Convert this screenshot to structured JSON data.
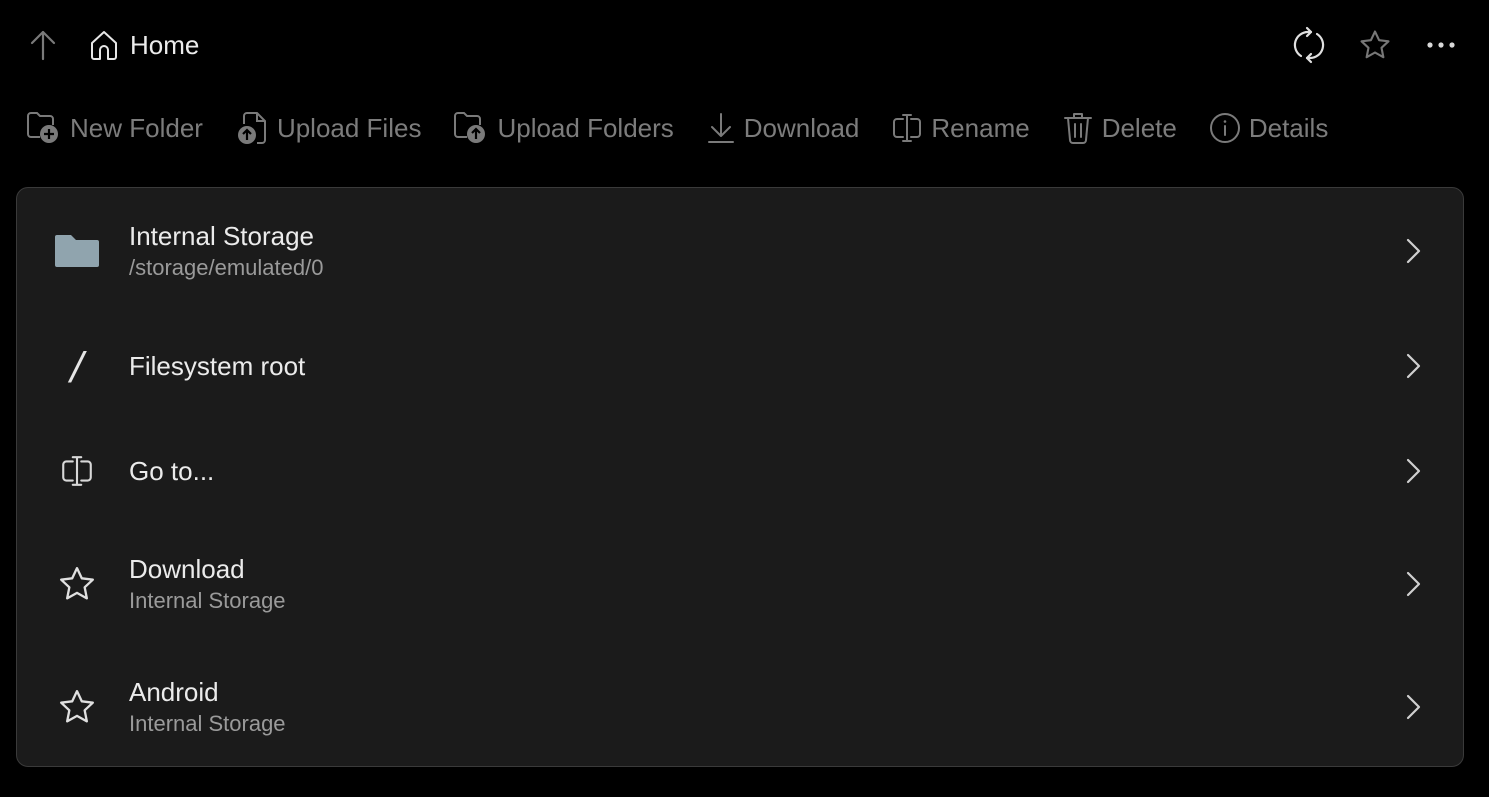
{
  "topbar": {
    "up_icon": "arrow-up-icon",
    "home_icon": "home-icon",
    "breadcrumb_label": "Home",
    "actions": [
      {
        "name": "refresh",
        "icon": "refresh-icon"
      },
      {
        "name": "favorite",
        "icon": "star-icon"
      },
      {
        "name": "more",
        "icon": "more-horizontal-icon"
      }
    ]
  },
  "toolbar": {
    "items": [
      {
        "label": "New Folder",
        "icon": "folder-add-icon"
      },
      {
        "label": "Upload Files",
        "icon": "file-upload-icon"
      },
      {
        "label": "Upload Folders",
        "icon": "folder-upload-icon"
      },
      {
        "label": "Download",
        "icon": "download-icon"
      },
      {
        "label": "Rename",
        "icon": "rename-icon"
      },
      {
        "label": "Delete",
        "icon": "trash-icon"
      },
      {
        "label": "Details",
        "icon": "info-icon"
      }
    ]
  },
  "locations": [
    {
      "title": "Internal Storage",
      "subtitle": "/storage/emulated/0",
      "icon": "folder-icon"
    },
    {
      "title": "Filesystem root",
      "subtitle": "",
      "icon": "slash-icon",
      "glyph": "/"
    },
    {
      "title": "Go to...",
      "subtitle": "",
      "icon": "text-cursor-icon"
    },
    {
      "title": "Download",
      "subtitle": "Internal Storage",
      "icon": "star-icon"
    },
    {
      "title": "Android",
      "subtitle": "Internal Storage",
      "icon": "star-icon"
    }
  ],
  "colors": {
    "background": "#000000",
    "card": "#1b1b1b",
    "folder_icon": "#90a4ae",
    "toolbar_text": "#7c7c7c"
  }
}
